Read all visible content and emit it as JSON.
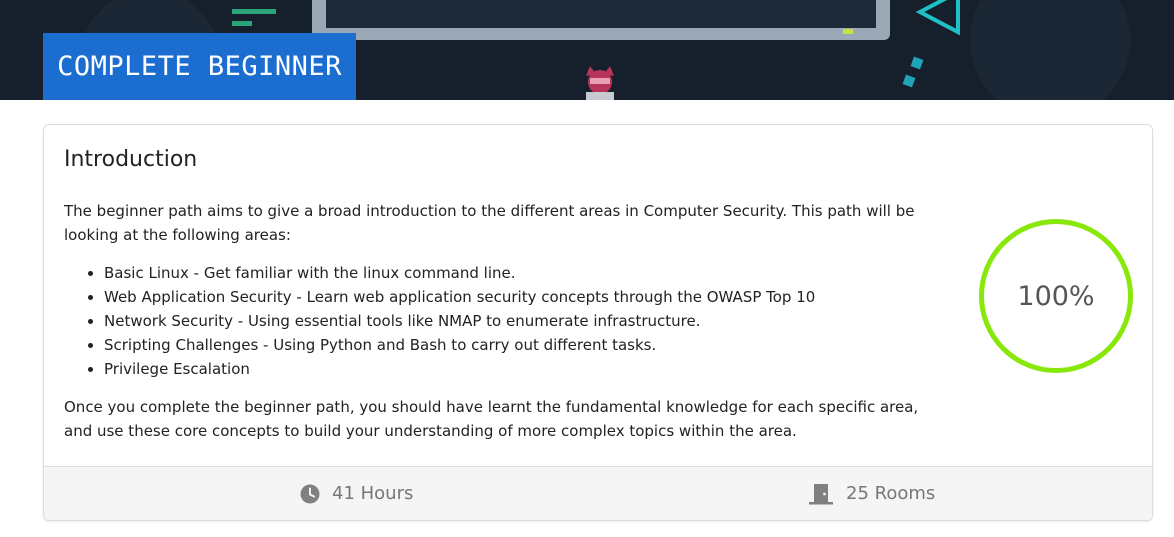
{
  "path": {
    "badge_label": "COMPLETE BEGINNER"
  },
  "card": {
    "title": "Introduction",
    "intro": "The beginner path aims to give a broad introduction to the different areas in Computer Security. This path will be looking at the following areas:",
    "areas": [
      "Basic Linux - Get familiar with the linux command line.",
      "Web Application Security - Learn web application security concepts through the OWASP Top 10",
      "Network Security - Using essential tools like NMAP to enumerate infrastructure.",
      "Scripting Challenges - Using Python and Bash to carry out different tasks.",
      "Privilege Escalation"
    ],
    "outro": "Once you complete the beginner path, you should have learnt the fundamental knowledge for each specific area, and use these core concepts to build your understanding of more complex topics within the area.",
    "progress": {
      "label": "100%",
      "percent": 100,
      "ring_color": "#88e80a"
    }
  },
  "footer": {
    "hours_icon": "clock-icon",
    "hours_label": "41 Hours",
    "rooms_icon": "door-icon",
    "rooms_label": "25 Rooms"
  },
  "colors": {
    "hero_background": "#16202c",
    "badge_background": "#1c6dd0"
  }
}
